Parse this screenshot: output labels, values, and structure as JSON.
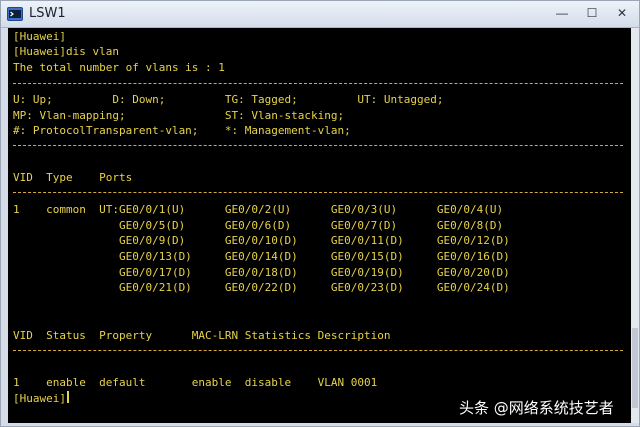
{
  "window": {
    "title": "LSW1",
    "minimize_glyph": "—",
    "maximize_glyph": "☐",
    "close_glyph": "✕"
  },
  "terminal": {
    "lines": {
      "l0": "[Huawei]",
      "l1": "[Huawei]dis vlan",
      "l2": "The total number of vlans is : 1",
      "l3": "U: Up;         D: Down;         TG: Tagged;         UT: Untagged;",
      "l4": "MP: Vlan-mapping;               ST: Vlan-stacking;",
      "l5": "#: ProtocolTransparent-vlan;    *: Management-vlan;",
      "l6": "VID  Type    Ports",
      "l7": "1    common  UT:GE0/0/1(U)      GE0/0/2(U)      GE0/0/3(U)      GE0/0/4(U)",
      "l8": "                GE0/0/5(D)      GE0/0/6(D)      GE0/0/7(D)      GE0/0/8(D)",
      "l9": "                GE0/0/9(D)      GE0/0/10(D)     GE0/0/11(D)     GE0/0/12(D)",
      "l10": "                GE0/0/13(D)     GE0/0/14(D)     GE0/0/15(D)     GE0/0/16(D)",
      "l11": "                GE0/0/17(D)     GE0/0/18(D)     GE0/0/19(D)     GE0/0/20(D)",
      "l12": "                GE0/0/21(D)     GE0/0/22(D)     GE0/0/23(D)     GE0/0/24(D)",
      "l13": "VID  Status  Property      MAC-LRN Statistics Description",
      "l14": "1    enable  default       enable  disable    VLAN 0001",
      "l15": "[Huawei]"
    }
  },
  "watermark": "头条 @网络系统技艺者",
  "colors": {
    "terminal_bg": "#000000",
    "terminal_text": "#e6d34a",
    "separator": "#d7a93b"
  }
}
